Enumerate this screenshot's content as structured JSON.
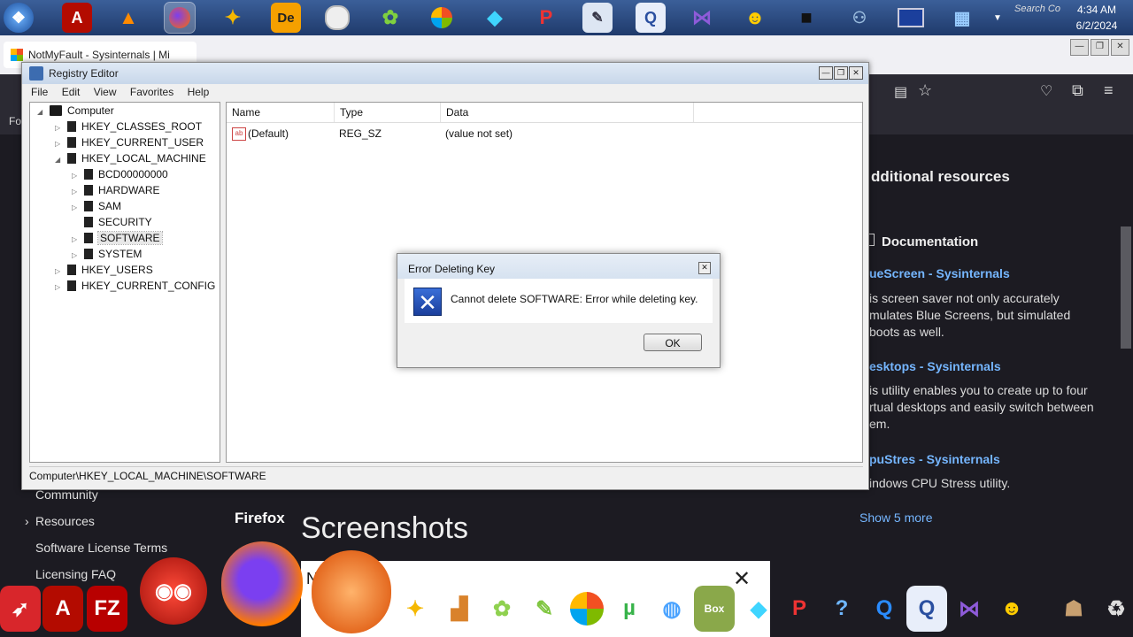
{
  "taskbar": {
    "search_snippet": "Search Co",
    "clock_time": "4:34 AM",
    "clock_date": "6/2/2024"
  },
  "browser": {
    "tab_title": "NotMyFault - Sysinternals | Mi",
    "right_pane": {
      "section_title": "dditional resources",
      "documentation_title": "Documentation",
      "items": [
        {
          "link": "ueScreen - Sysinternals",
          "lines": [
            "is screen saver not only accurately",
            "mulates Blue Screens, but simulated",
            "boots as well."
          ]
        },
        {
          "link": "esktops - Sysinternals",
          "lines": [
            "is utility enables you to create up to four",
            "rtual desktops and easily switch between",
            "em."
          ]
        },
        {
          "link": "puStres - Sysinternals",
          "lines": [
            "indows CPU Stress utility."
          ]
        }
      ],
      "show_more": "Show 5 more"
    },
    "left_nav": {
      "partial": "Fo",
      "items": [
        "Community",
        "Resources",
        "Software License Terms",
        "Licensing FAQ"
      ]
    },
    "screenshots_heading": "Screenshots",
    "firefox_label": "Firefox",
    "popup_fragment": "N               lt",
    "popup_close_glyph": "✕"
  },
  "regedit": {
    "title": "Registry Editor",
    "menu": [
      "File",
      "Edit",
      "View",
      "Favorites",
      "Help"
    ],
    "tree": [
      {
        "label": "Computer",
        "level": 0,
        "expander": "◢",
        "kind": "pc"
      },
      {
        "label": "HKEY_CLASSES_ROOT",
        "level": 1,
        "expander": "▷"
      },
      {
        "label": "HKEY_CURRENT_USER",
        "level": 1,
        "expander": "▷"
      },
      {
        "label": "HKEY_LOCAL_MACHINE",
        "level": 1,
        "expander": "◢"
      },
      {
        "label": "BCD00000000",
        "level": 2,
        "expander": "▷"
      },
      {
        "label": "HARDWARE",
        "level": 2,
        "expander": "▷"
      },
      {
        "label": "SAM",
        "level": 2,
        "expander": "▷"
      },
      {
        "label": "SECURITY",
        "level": 2,
        "expander": ""
      },
      {
        "label": "SOFTWARE",
        "level": 2,
        "expander": "▷",
        "selected": true
      },
      {
        "label": "SYSTEM",
        "level": 2,
        "expander": "▷"
      },
      {
        "label": "HKEY_USERS",
        "level": 1,
        "expander": "▷"
      },
      {
        "label": "HKEY_CURRENT_CONFIG",
        "level": 1,
        "expander": "▷"
      }
    ],
    "columns": [
      "Name",
      "Type",
      "Data"
    ],
    "rows": [
      {
        "name": "(Default)",
        "type": "REG_SZ",
        "data": "(value not set)",
        "icon_label": "ab"
      }
    ],
    "status_path": "Computer\\HKEY_LOCAL_MACHINE\\SOFTWARE"
  },
  "dialog": {
    "title": "Error Deleting Key",
    "message": "Cannot delete SOFTWARE:  Error while deleting key.",
    "ok_label": "OK",
    "icon_glyph": "✕",
    "close_glyph": "✕"
  },
  "colors": {
    "accent_link": "#75b6ff",
    "page_bg": "#1c1b22",
    "error_icon": "#1b3f9c"
  }
}
